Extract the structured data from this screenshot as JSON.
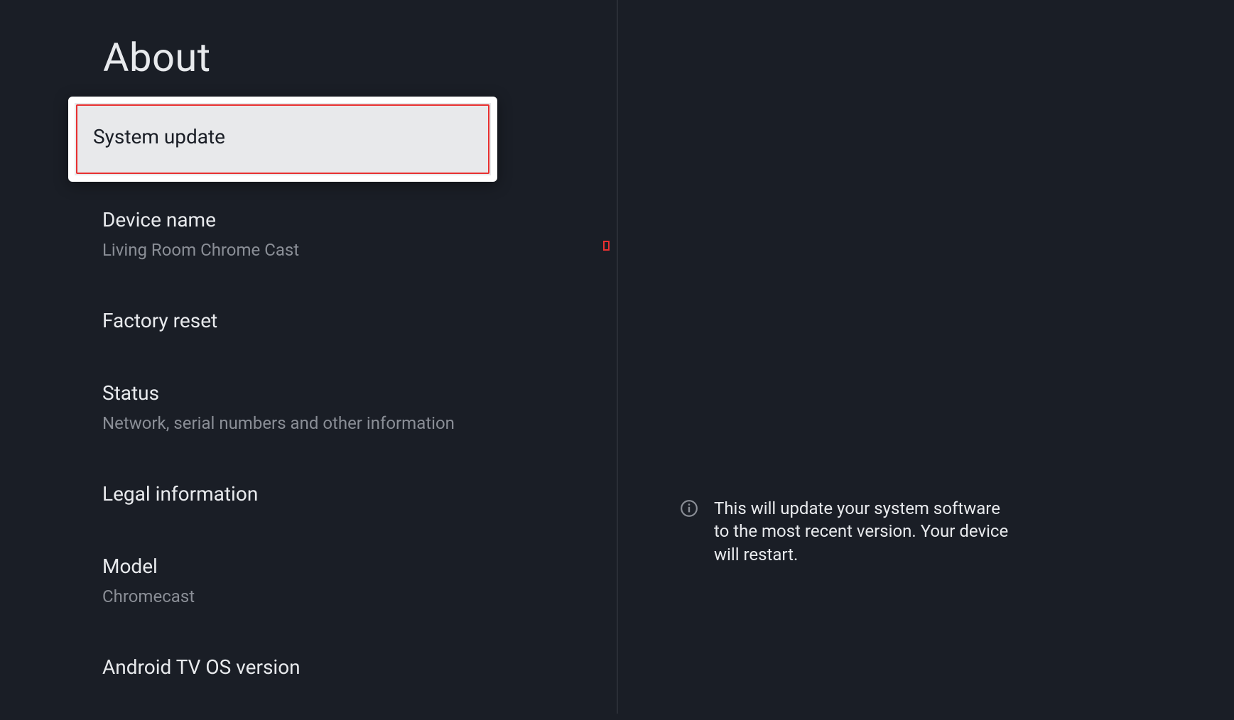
{
  "page_title": "About",
  "menu": {
    "items": [
      {
        "title": "System update",
        "subtitle": null,
        "focused": true
      },
      {
        "title": "Device name",
        "subtitle": "Living Room Chrome Cast",
        "focused": false
      },
      {
        "title": "Factory reset",
        "subtitle": null,
        "focused": false
      },
      {
        "title": "Status",
        "subtitle": "Network, serial numbers and other information",
        "focused": false
      },
      {
        "title": "Legal information",
        "subtitle": null,
        "focused": false
      },
      {
        "title": "Model",
        "subtitle": "Chromecast",
        "focused": false
      },
      {
        "title": "Android TV OS version",
        "subtitle": null,
        "focused": false
      }
    ]
  },
  "info_panel": {
    "text": "This will update your system software to the most recent version. Your device will restart."
  }
}
